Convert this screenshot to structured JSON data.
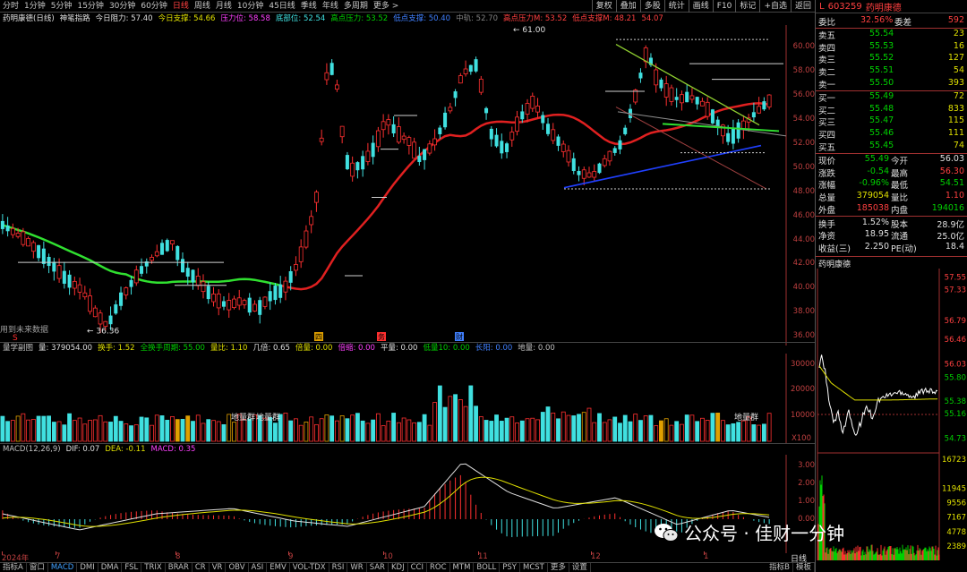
{
  "toolbar": {
    "periods": [
      "分时",
      "1分钟",
      "5分钟",
      "15分钟",
      "30分钟",
      "60分钟",
      "日线",
      "周线",
      "月线",
      "10分钟",
      "45日线",
      "季线",
      "年线",
      "多周期",
      "更多 >"
    ],
    "active_period": "日线",
    "buttons": [
      "复权",
      "叠加",
      "多股",
      "统计",
      "画线",
      "F10",
      "标记",
      "+自选",
      "返回"
    ]
  },
  "info": {
    "stock": "药明康德(日线)",
    "indicator": "神笔指路",
    "items": [
      {
        "label": "今日阻力:",
        "value": "57.40",
        "color": "#e0e0e0"
      },
      {
        "label": "今日支撑:",
        "value": "54.66",
        "color": "#e0e000"
      },
      {
        "label": "压力位:",
        "value": "58.58",
        "color": "#ff40ff"
      },
      {
        "label": "底部位:",
        "value": "52.54",
        "color": "#40e0e0"
      },
      {
        "label": "高点压力:",
        "value": "53.52",
        "color": "#00d000"
      },
      {
        "label": "低点支撑:",
        "value": "50.40",
        "color": "#4080ff"
      },
      {
        "label": "中轨:",
        "value": "52.70",
        "color": "#808080"
      },
      {
        "label": "高点压力M:",
        "value": "53.52",
        "color": "#ff4040"
      },
      {
        "label": "低点支撑M:",
        "value": "48.21",
        "color": "#ff4040"
      },
      {
        "label": "",
        "value": "54.07",
        "color": "#ff4040"
      }
    ]
  },
  "main_axis": [
    "60.00",
    "58.00",
    "56.00",
    "54.00",
    "52.00",
    "50.00",
    "48.00",
    "46.00",
    "44.00",
    "42.00",
    "40.00",
    "38.00",
    "36.00"
  ],
  "annotations": {
    "high": "61.00",
    "low": "36.36",
    "hint": "用到未来数据",
    "markers": [
      "S",
      "四",
      "务",
      "财"
    ]
  },
  "volume": {
    "info": [
      {
        "label": "量学副图",
        "value": "",
        "color": "#c0c0c0"
      },
      {
        "label": "量:",
        "value": "379054.00",
        "color": "#e0e0e0"
      },
      {
        "label": "换手:",
        "value": "1.52",
        "color": "#e0e000"
      },
      {
        "label": "全换手周期:",
        "value": "55.00",
        "color": "#00d000"
      },
      {
        "label": "量比:",
        "value": "1.10",
        "color": "#e0e000"
      },
      {
        "label": "几倍:",
        "value": "0.65",
        "color": "#e0e0e0"
      },
      {
        "label": "倍量:",
        "value": "0.00",
        "color": "#e0e000"
      },
      {
        "label": "倍缩:",
        "value": "0.00",
        "color": "#ff40ff"
      },
      {
        "label": "平量:",
        "value": "0.00",
        "color": "#e0e0e0"
      },
      {
        "label": "低量10:",
        "value": "0.00",
        "color": "#00d000"
      },
      {
        "label": "长阳:",
        "value": "0.00",
        "color": "#4080ff"
      },
      {
        "label": "地量:",
        "value": "0.00",
        "color": "#c0c0c0"
      }
    ],
    "axis": [
      "30000",
      "20000",
      "10000"
    ],
    "unit": "X100",
    "labels": [
      "地量群",
      "地量群",
      "地量群"
    ]
  },
  "macd": {
    "info": [
      {
        "label": "MACD(12,26,9)",
        "value": "",
        "color": "#c0c0c0"
      },
      {
        "label": "DIF:",
        "value": "0.07",
        "color": "#e0e0e0"
      },
      {
        "label": "DEA:",
        "value": "-0.11",
        "color": "#e0e000"
      },
      {
        "label": "MACD:",
        "value": "0.35",
        "color": "#ff40ff"
      }
    ],
    "axis": [
      "3.00",
      "2.00",
      "1.00",
      "0.00"
    ]
  },
  "dates": [
    "2024年",
    "7",
    "8",
    "9",
    "10",
    "11",
    "12",
    "1"
  ],
  "bottom_tabs": [
    "指标A",
    "窗口",
    "MACD",
    "DMI",
    "DMA",
    "FSL",
    "TRIX",
    "BRAR",
    "CR",
    "VR",
    "OBV",
    "ASI",
    "EMV",
    "VOL-TDX",
    "RSI",
    "WR",
    "SAR",
    "KDJ",
    "CCI",
    "ROC",
    "MTM",
    "BOLL",
    "PSY",
    "MCST",
    "更多",
    "设置"
  ],
  "bottom_right": [
    "指标B",
    "模板"
  ],
  "active_tab": "MACD",
  "right": {
    "code": "603259",
    "name": "药明康德",
    "weibi": {
      "label": "委比",
      "value": "32.56%",
      "label2": "委差",
      "value2": "592"
    },
    "asks": [
      {
        "label": "卖五",
        "price": "55.54",
        "vol": "23"
      },
      {
        "label": "卖四",
        "price": "55.53",
        "vol": "16"
      },
      {
        "label": "卖三",
        "price": "55.52",
        "vol": "127"
      },
      {
        "label": "卖二",
        "price": "55.51",
        "vol": "54"
      },
      {
        "label": "卖一",
        "price": "55.50",
        "vol": "393"
      }
    ],
    "bids": [
      {
        "label": "买一",
        "price": "55.49",
        "vol": "72"
      },
      {
        "label": "买二",
        "price": "55.48",
        "vol": "833"
      },
      {
        "label": "买三",
        "price": "55.47",
        "vol": "115"
      },
      {
        "label": "买四",
        "price": "55.46",
        "vol": "111"
      },
      {
        "label": "买五",
        "price": "55.45",
        "vol": "74"
      }
    ],
    "quote": [
      {
        "l1": "现价",
        "v1": "55.49",
        "c1": "#00d000",
        "l2": "今开",
        "v2": "56.03",
        "c2": "#e0e0e0"
      },
      {
        "l1": "涨跌",
        "v1": "-0.54",
        "c1": "#00d000",
        "l2": "最高",
        "v2": "56.30",
        "c2": "#ff4040"
      },
      {
        "l1": "涨幅",
        "v1": "-0.96%",
        "c1": "#00d000",
        "l2": "最低",
        "v2": "54.51",
        "c2": "#00d000"
      },
      {
        "l1": "总量",
        "v1": "379054",
        "c1": "#e0e000",
        "l2": "量比",
        "v2": "1.10",
        "c2": "#ff4040"
      },
      {
        "l1": "外盘",
        "v1": "185038",
        "c1": "#ff4040",
        "l2": "内盘",
        "v2": "194016",
        "c2": "#00d000"
      },
      {
        "l1": "换手",
        "v1": "1.52%",
        "c1": "#e0e0e0",
        "l2": "股本",
        "v2": "28.9亿",
        "c2": "#e0e0e0"
      },
      {
        "l1": "净资",
        "v1": "18.95",
        "c1": "#e0e0e0",
        "l2": "流通",
        "v2": "25.0亿",
        "c2": "#e0e0e0"
      },
      {
        "l1": "收益(三)",
        "v1": "2.250",
        "c1": "#e0e0e0",
        "l2": "PE(动)",
        "v2": "18.4",
        "c2": "#e0e0e0"
      }
    ],
    "mini_name": "药明康德",
    "mini_axis": [
      "57.55",
      "57.33",
      "56.79",
      "56.46",
      "56.03",
      "55.80",
      "55.38",
      "55.16",
      "54.73"
    ],
    "mini_vol_axis": [
      "16723",
      "11945",
      "9556",
      "7167",
      "4778",
      "2389"
    ],
    "bottom_tab": "日线"
  },
  "watermark": "公众号 · 佳财一分钟"
}
